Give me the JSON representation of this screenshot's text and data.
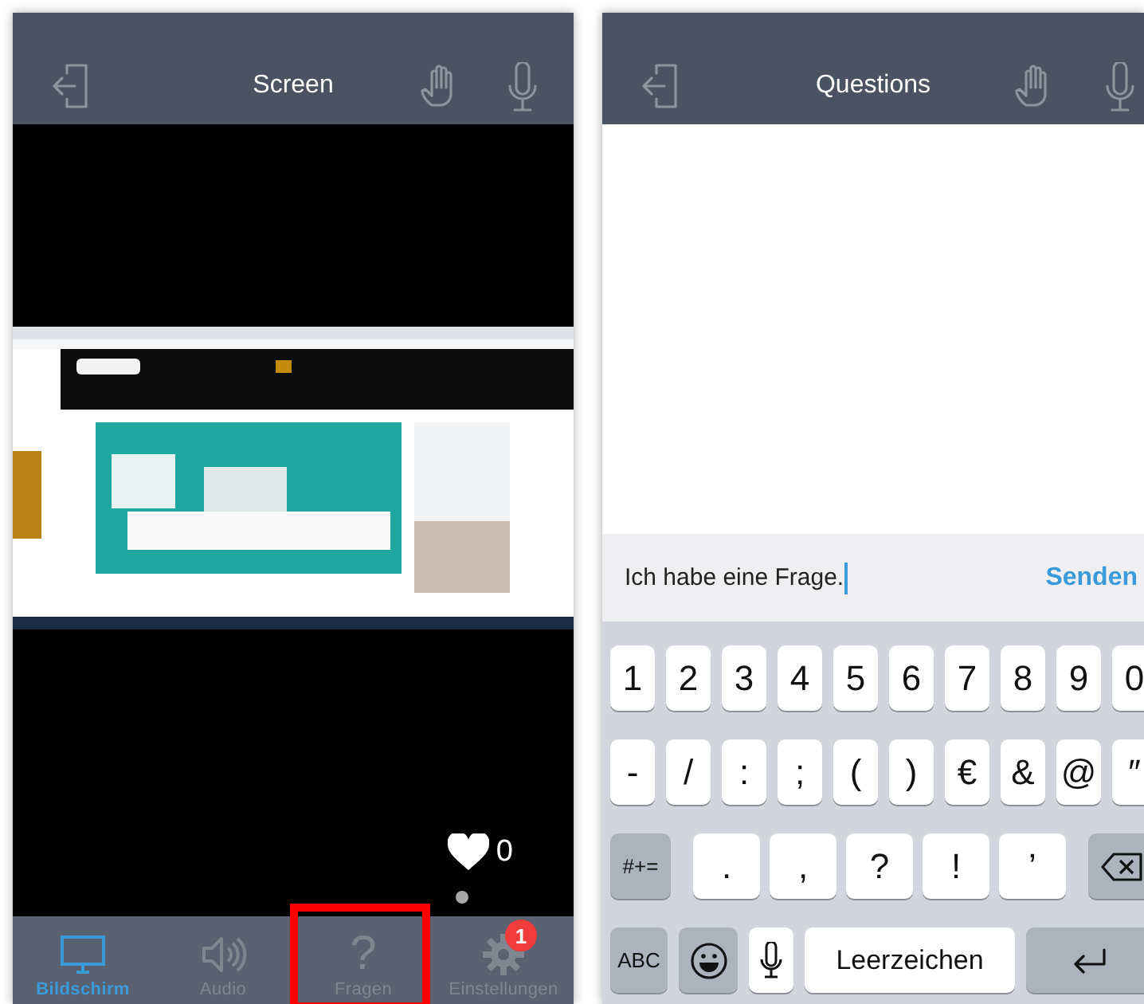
{
  "left_screen": {
    "header": {
      "title": "Screen"
    },
    "likes": {
      "count": "0"
    },
    "tabs": [
      {
        "label": "Bildschirm",
        "selected": true,
        "highlighted": false
      },
      {
        "label": "Audio",
        "selected": false,
        "highlighted": false
      },
      {
        "label": "Fragen",
        "glyph": "?",
        "selected": false,
        "highlighted": true
      },
      {
        "label": "Einstellungen",
        "badge": "1",
        "selected": false,
        "highlighted": false
      }
    ]
  },
  "right_screen": {
    "header": {
      "title": "Questions"
    },
    "question_input": {
      "value": "Ich habe eine Frage."
    },
    "send_button": "Senden",
    "keyboard": {
      "rows": [
        {
          "kind": "digits",
          "keys": [
            {
              "kind": "char",
              "label": "1"
            },
            {
              "kind": "char",
              "label": "2"
            },
            {
              "kind": "char",
              "label": "3"
            },
            {
              "kind": "char",
              "label": "4"
            },
            {
              "kind": "char",
              "label": "5"
            },
            {
              "kind": "char",
              "label": "6"
            },
            {
              "kind": "char",
              "label": "7"
            },
            {
              "kind": "char",
              "label": "8"
            },
            {
              "kind": "char",
              "label": "9"
            },
            {
              "kind": "char",
              "label": "0"
            }
          ]
        },
        {
          "kind": "symbols",
          "keys": [
            {
              "kind": "char",
              "label": "-"
            },
            {
              "kind": "char",
              "label": "/"
            },
            {
              "kind": "char",
              "label": ":"
            },
            {
              "kind": "char",
              "label": ";"
            },
            {
              "kind": "char",
              "label": "("
            },
            {
              "kind": "char",
              "label": ")"
            },
            {
              "kind": "char",
              "label": "€"
            },
            {
              "kind": "char",
              "label": "&"
            },
            {
              "kind": "char",
              "label": "@"
            },
            {
              "kind": "char",
              "label": "″"
            }
          ]
        },
        {
          "kind": "punctuation",
          "keys": [
            {
              "kind": "mode",
              "label": "#+="
            },
            {
              "kind": "char",
              "label": "."
            },
            {
              "kind": "char",
              "label": ","
            },
            {
              "kind": "char",
              "label": "?"
            },
            {
              "kind": "char",
              "label": "!"
            },
            {
              "kind": "char",
              "label": "’"
            },
            {
              "kind": "backspace"
            }
          ]
        },
        {
          "kind": "bottom",
          "keys": [
            {
              "kind": "mode",
              "label": "ABC"
            },
            {
              "kind": "emoji"
            },
            {
              "kind": "mic"
            },
            {
              "kind": "space",
              "label": "Leerzeichen"
            },
            {
              "kind": "return"
            }
          ]
        }
      ]
    }
  }
}
